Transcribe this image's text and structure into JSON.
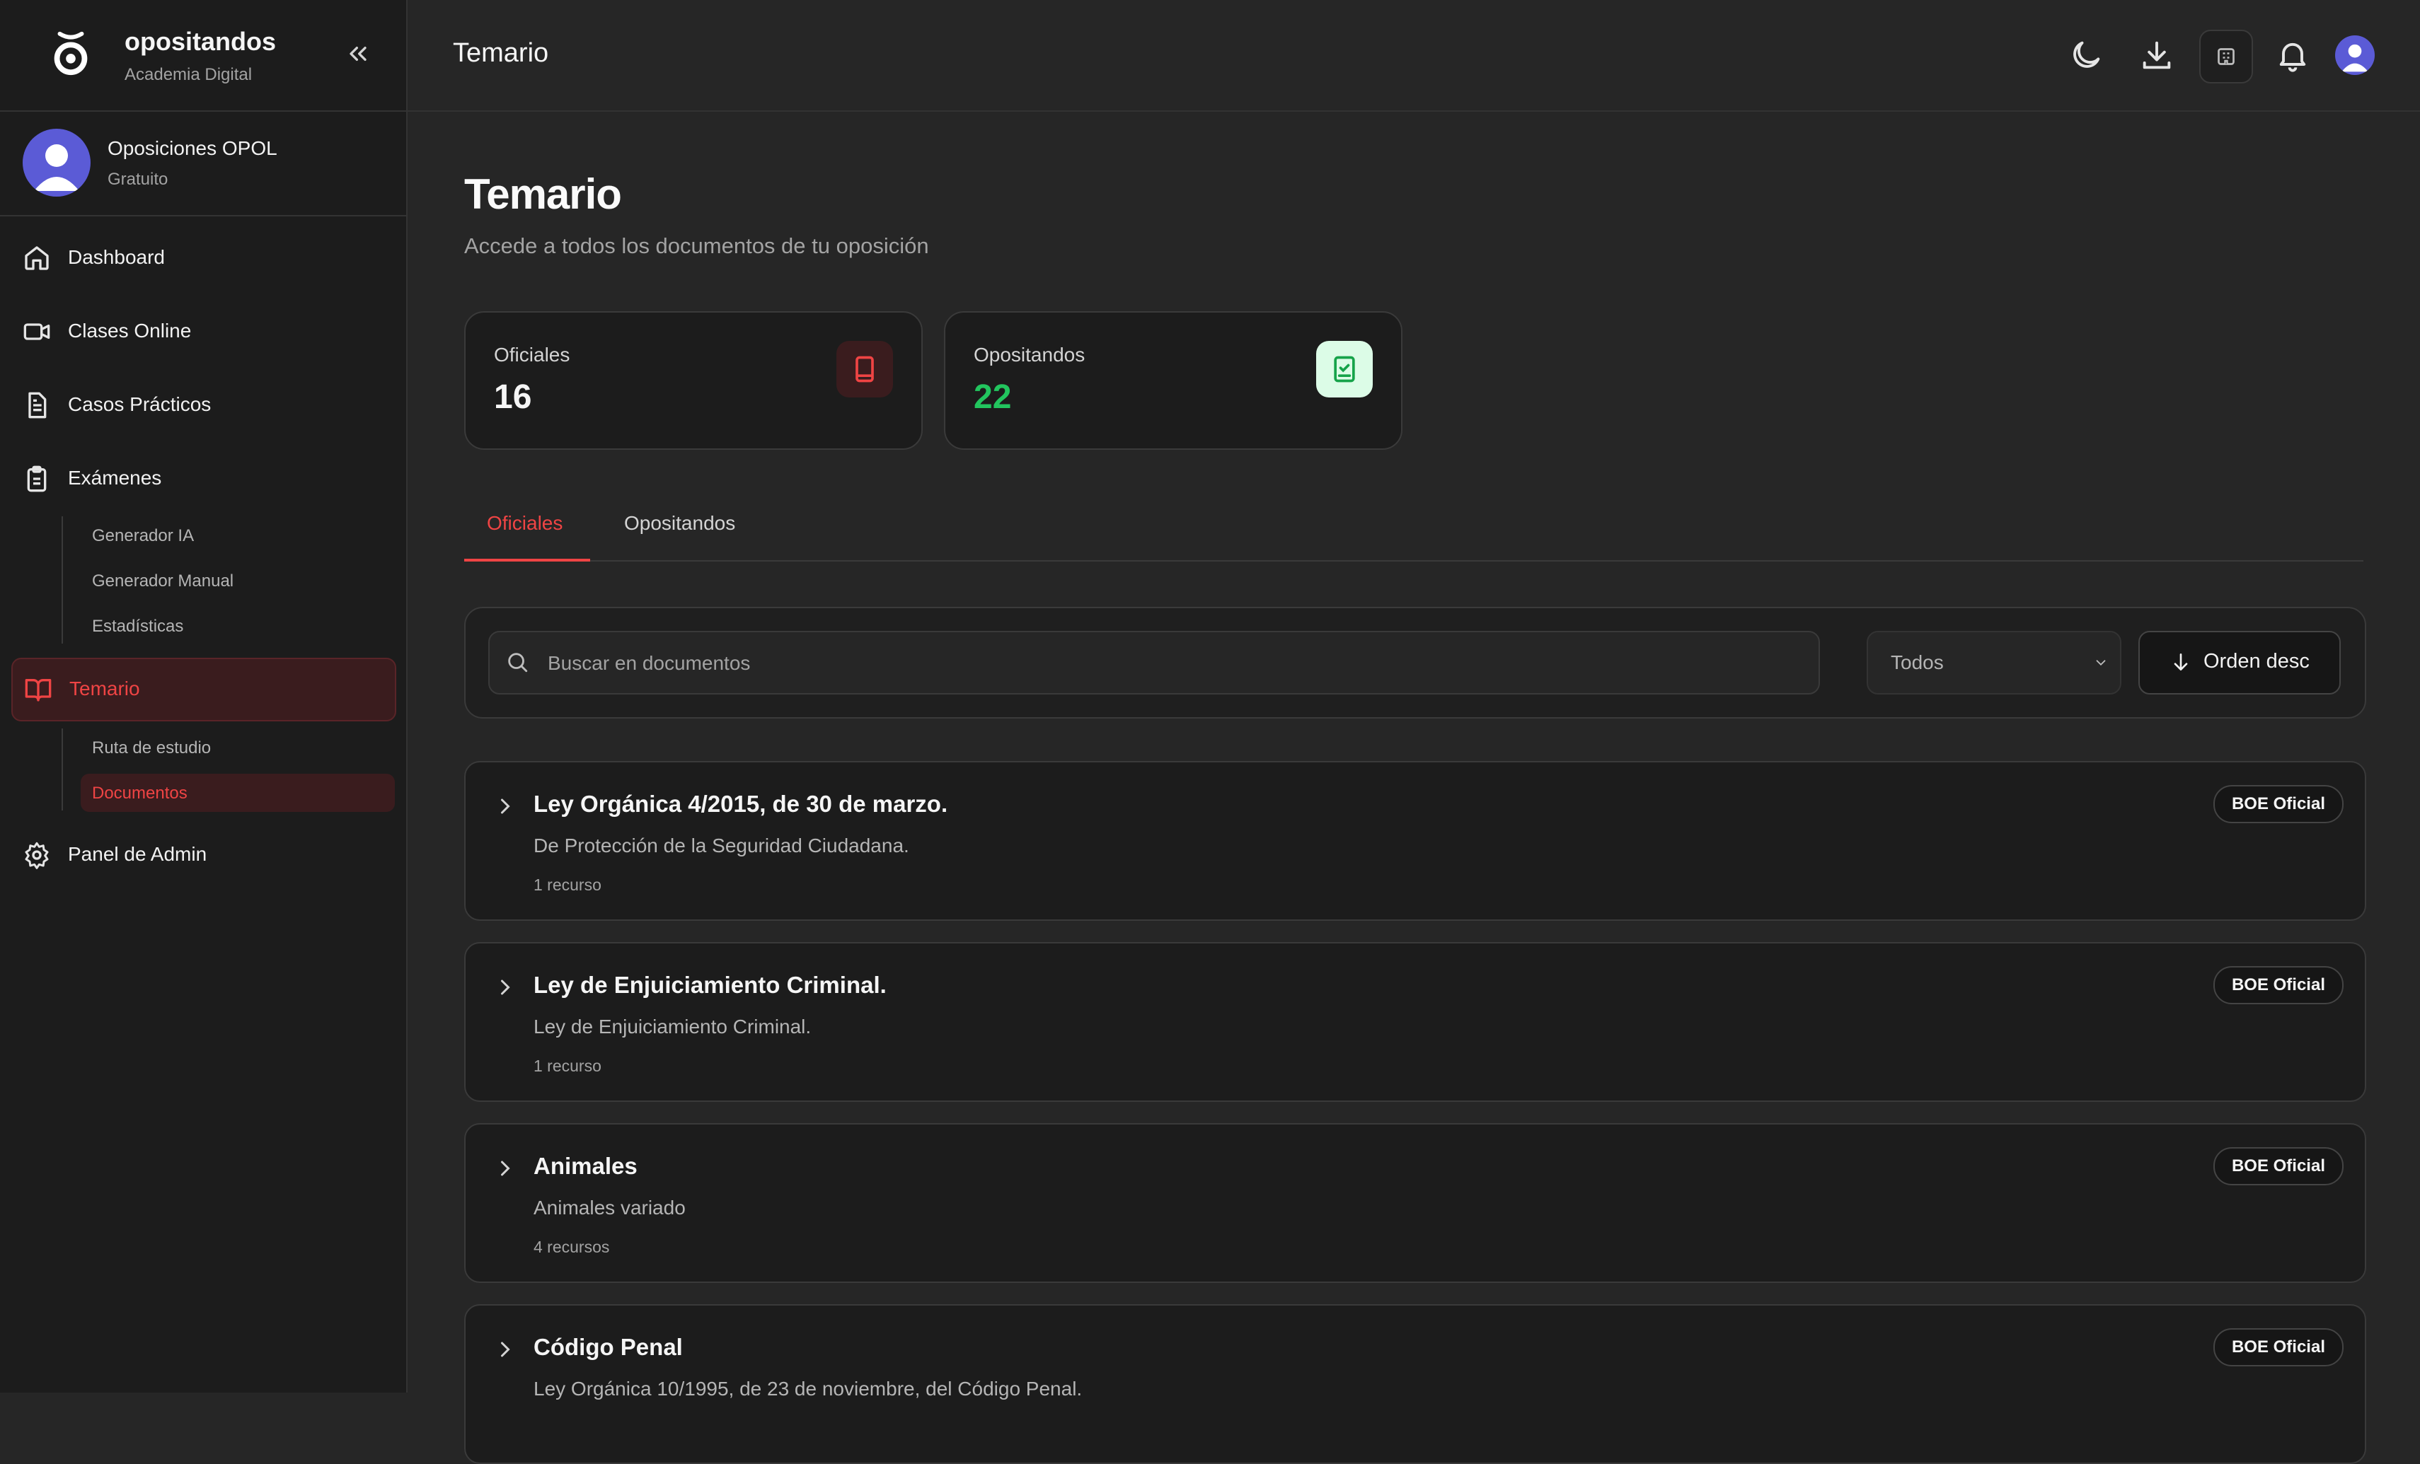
{
  "brand": {
    "name": "opositandos",
    "subtitle": "Academia Digital"
  },
  "profile": {
    "name": "Oposiciones OPOL",
    "plan": "Gratuito"
  },
  "sidebar": {
    "items": [
      {
        "label": "Dashboard",
        "icon": "home-icon"
      },
      {
        "label": "Clases Online",
        "icon": "video-icon"
      },
      {
        "label": "Casos Prácticos",
        "icon": "document-icon"
      },
      {
        "label": "Exámenes",
        "icon": "clipboard-icon"
      },
      {
        "label": "Temario",
        "icon": "book-open-icon",
        "active": true
      },
      {
        "label": "Panel de Admin",
        "icon": "gear-icon"
      }
    ],
    "examenes_sub": [
      "Generador IA",
      "Generador Manual",
      "Estadísticas"
    ],
    "temario_sub": [
      "Ruta de estudio",
      "Documentos"
    ]
  },
  "topbar": {
    "title": "Temario"
  },
  "page": {
    "title": "Temario",
    "subtitle": "Accede a todos los documentos de tu oposición"
  },
  "stats": [
    {
      "label": "Oficiales",
      "value": "16",
      "color": "#f5f5f5",
      "icon": "book-icon",
      "icon_bg": "#3a1c1e",
      "icon_color": "#ef4444"
    },
    {
      "label": "Opositandos",
      "value": "22",
      "color": "#22c55e",
      "icon": "checklist-icon",
      "icon_bg": "#dcfce7",
      "icon_color": "#16a34a"
    }
  ],
  "tabs": [
    {
      "label": "Oficiales",
      "active": true
    },
    {
      "label": "Opositandos",
      "active": false
    }
  ],
  "filters": {
    "search_placeholder": "Buscar en documentos",
    "select_value": "Todos",
    "order_label": "Orden desc"
  },
  "documents": [
    {
      "title": "Ley Orgánica 4/2015, de 30 de marzo.",
      "description": "De Protección de la Seguridad Ciudadana.",
      "count": "1 recurso",
      "badge": "BOE Oficial"
    },
    {
      "title": "Ley de Enjuiciamiento Criminal.",
      "description": "Ley de Enjuiciamiento Criminal.",
      "count": "1 recurso",
      "badge": "BOE Oficial"
    },
    {
      "title": "Animales",
      "description": "Animales variado",
      "count": "4 recursos",
      "badge": "BOE Oficial"
    },
    {
      "title": "Código Penal",
      "description": "Ley Orgánica 10/1995, de 23 de noviembre, del Código Penal.",
      "count": "",
      "badge": "BOE Oficial"
    }
  ],
  "colors": {
    "accent": "#ef4444",
    "success": "#22c55e",
    "background": "#262626",
    "sidebar": "#1c1c1c"
  }
}
